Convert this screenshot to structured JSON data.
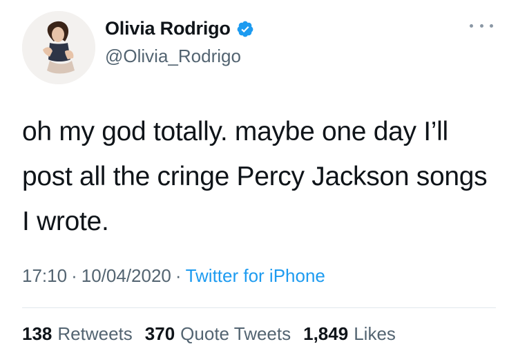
{
  "author": {
    "name": "Olivia Rodrigo",
    "handle": "@Olivia_Rodrigo",
    "verified": true,
    "verified_color": "#1d9bf0"
  },
  "tweet": {
    "text": "oh my god totally. maybe one day I’ll post all the cringe Percy Jackson songs I wrote."
  },
  "meta": {
    "time": "17:10",
    "sep1": "·",
    "date": "10/04/2020",
    "sep2": "·",
    "source": "Twitter for iPhone"
  },
  "stats": {
    "retweets_count": "138",
    "retweets_label": "Retweets",
    "quotes_count": "370",
    "quotes_label": "Quote Tweets",
    "likes_count": "1,849",
    "likes_label": "Likes"
  },
  "icons": {
    "avatar": "profile-photo",
    "verified": "verified-badge-icon",
    "more": "more-options-icon"
  }
}
